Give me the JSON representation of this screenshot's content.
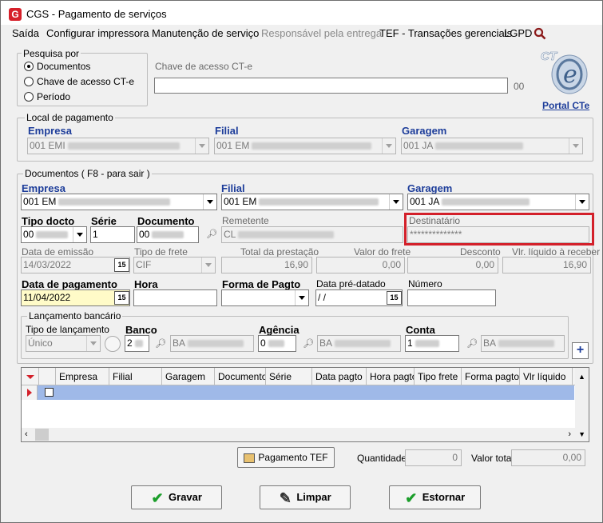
{
  "window": {
    "title": "CGS - Pagamento de serviços"
  },
  "menu": {
    "items": [
      "Saída",
      "Configurar impressora",
      "Manutenção de serviço",
      "Responsável pela entrega",
      "TEF - Transações gerenciais",
      "LGPD"
    ]
  },
  "search_panel": {
    "title": "Pesquisa por",
    "options": [
      "Documentos",
      "Chave de acesso CT-e",
      "Período"
    ],
    "selected": "Documentos",
    "key_label": "Chave de acesso CT-e",
    "key_value": "",
    "key_suffix": "00"
  },
  "portal": {
    "label": "Portal CTe",
    "logo_text": "CT-e"
  },
  "local_pagamento": {
    "title": "Local de pagamento",
    "empresa_label": "Empresa",
    "empresa_value": "001 EMI",
    "filial_label": "Filial",
    "filial_value": "001 EM",
    "garagem_label": "Garagem",
    "garagem_value": "001 JA"
  },
  "documentos": {
    "title": "Documentos ( F8 - para sair )",
    "empresa_label": "Empresa",
    "empresa_value": "001 EM",
    "filial_label": "Filial",
    "filial_value": "001 EM",
    "garagem_label": "Garagem",
    "garagem_value": "001 JA",
    "tipo_docto_label": "Tipo docto",
    "tipo_docto_value": "00",
    "serie_label": "Série",
    "serie_value": "1",
    "documento_label": "Documento",
    "documento_value": "00",
    "remetente_label": "Remetente",
    "remetente_value": "CL",
    "destinatario_label": "Destinatário",
    "destinatario_value": "**************",
    "data_emissao_label": "Data de emissão",
    "data_emissao_value": "14/03/2022",
    "tipo_frete_label": "Tipo de frete",
    "tipo_frete_value": "CIF",
    "total_prestacao_label": "Total da prestação",
    "total_prestacao_value": "16,90",
    "valor_frete_label": "Valor do frete",
    "valor_frete_value": "0,00",
    "desconto_label": "Desconto",
    "desconto_value": "0,00",
    "liquido_label": "Vlr. líquido à receber",
    "liquido_value": "16,90",
    "data_pagamento_label": "Data de pagamento",
    "data_pagamento_value": "11/04/2022",
    "hora_label": "Hora",
    "hora_value": "",
    "forma_pagto_label": "Forma de Pagto",
    "forma_pagto_value": "",
    "data_pre_label": "Data pré-datado",
    "data_pre_value": " /  /",
    "numero_label": "Número",
    "numero_value": ""
  },
  "lancamento": {
    "title": "Lançamento bancário",
    "tipo_label": "Tipo de lançamento",
    "tipo_value": "Único",
    "banco_label": "Banco",
    "banco_value": "2",
    "banco_name": "BA",
    "agencia_label": "Agência",
    "agencia_value": "0",
    "agencia_name": "BA",
    "conta_label": "Conta",
    "conta_value": "1",
    "conta_name": "BA"
  },
  "grid": {
    "columns": [
      "Empresa",
      "Filial",
      "Garagem",
      "Documento",
      "Série",
      "Data pagto",
      "Hora pagto",
      "Tipo frete",
      "Forma pagto",
      "Vlr líquido"
    ]
  },
  "footer": {
    "pagamento_tef": "Pagamento TEF",
    "quantidade_label": "Quantidade",
    "quantidade_value": "0",
    "valor_total_label": "Valor total",
    "valor_total_value": "0,00",
    "gravar": "Gravar",
    "limpar": "Limpar",
    "estornar": "Estornar"
  },
  "colors": {
    "highlight": "#d3202a",
    "link": "#1d3d9a",
    "row_selected": "#9fb9e8",
    "date_yellow": "#fffbc8"
  }
}
